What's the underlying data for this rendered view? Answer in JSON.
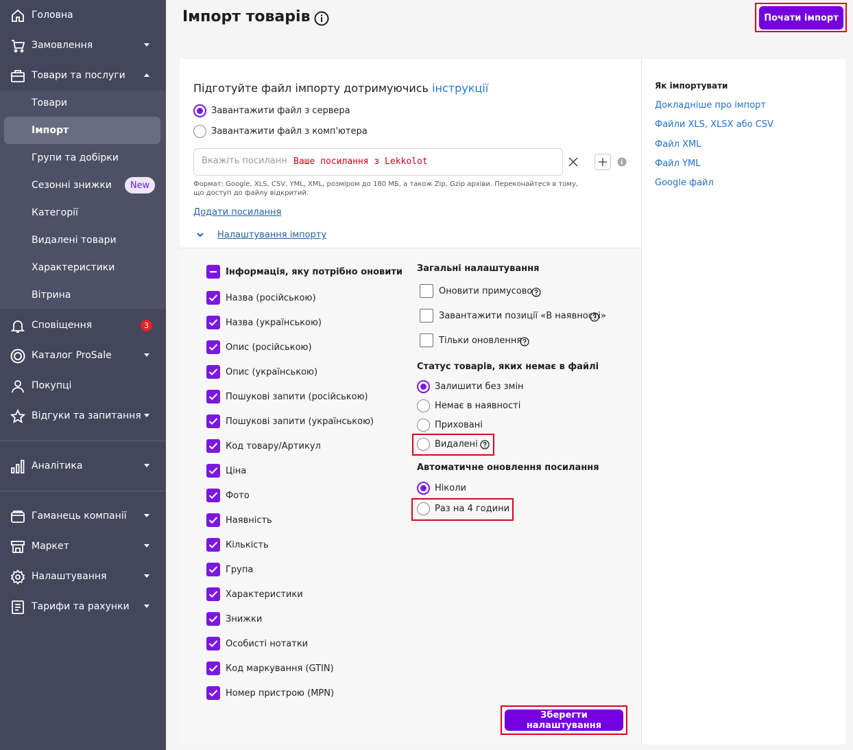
{
  "sidebar": {
    "items": [
      {
        "label": "Головна",
        "icon": "home-icon"
      },
      {
        "label": "Замовлення",
        "icon": "cart-icon"
      },
      {
        "label": "Товари та послуги",
        "icon": "box-icon"
      },
      {
        "label": "Сповіщення",
        "icon": "bell-icon",
        "badge": "3"
      },
      {
        "label": "Каталог ProSale",
        "icon": "target-icon"
      },
      {
        "label": "Покупці",
        "icon": "user-icon"
      },
      {
        "label": "Відгуки та запитання",
        "icon": "star-icon"
      },
      {
        "label": "Аналітика",
        "icon": "chart-icon"
      },
      {
        "label": "Гаманець компанії",
        "icon": "wallet-icon"
      },
      {
        "label": "Маркет",
        "icon": "store-icon"
      },
      {
        "label": "Налаштування",
        "icon": "gear-icon"
      },
      {
        "label": "Тарифи та рахунки",
        "icon": "list-icon"
      }
    ],
    "sub": [
      {
        "label": "Товари"
      },
      {
        "label": "Імпорт"
      },
      {
        "label": "Групи та добірки"
      },
      {
        "label": "Сезонні знижки",
        "badge": "New"
      },
      {
        "label": "Категорії"
      },
      {
        "label": "Видалені товари"
      },
      {
        "label": "Характеристики"
      },
      {
        "label": "Вітрина"
      }
    ]
  },
  "header": {
    "title": "Імпорт товарів",
    "start_label": "Почати імпорт"
  },
  "source": {
    "prep_text": "Підготуйте файл імпорту дотримуючись ",
    "prep_link": "інструкції",
    "server_label": "Завантажити файл з сервера",
    "computer_label": "Завантажити файл з комп'ютера",
    "url_placeholder": "Вкажіть посилання",
    "url_value": "Ваше посилання з Lekkolot",
    "format_note": "Формат: Google, XLS, CSV, YML, XML, розміром до 180 МБ, а також Zip, Gzip архіви. Переконайтеся в тому, що доступ до файлу відкритий.",
    "add_link": "Додати посилання",
    "settings_toggle": "Налаштування імпорту"
  },
  "update_info": {
    "title": "Інформація, яку потрібно оновити",
    "items": [
      "Назва (російською)",
      "Назва (українською)",
      "Опис (російською)",
      "Опис (українською)",
      "Пошукові запити (російською)",
      "Пошукові запити (українською)",
      "Код товару/Артикул",
      "Ціна",
      "Фото",
      "Наявність",
      "Кількість",
      "Група",
      "Характеристики",
      "Знижки",
      "Особисті нотатки",
      "Код маркування (GTIN)",
      "Номер пристрою (MPN)"
    ]
  },
  "general": {
    "title": "Загальні налаштування",
    "force_update": "Оновити примусово",
    "load_in_stock": "Завантажити позиції «В наявності»",
    "only_updates": "Тільки оновлення"
  },
  "status": {
    "title": "Статус товарів, яких немає в файлі",
    "keep": "Залишити без змін",
    "out_of_stock": "Немає в наявності",
    "hidden": "Приховані",
    "deleted": "Видалені"
  },
  "auto_update": {
    "title": "Автоматичне оновлення посилання",
    "never": "Ніколи",
    "every4h": "Раз на 4 години"
  },
  "save_label": "Зберегти налаштування",
  "help_panel": {
    "title": "Як імпортувати",
    "links": [
      "Докладніше про імпорт",
      "Файли XLS, XLSX або CSV",
      "Файл XML",
      "Файл YML",
      "Google файл"
    ]
  }
}
